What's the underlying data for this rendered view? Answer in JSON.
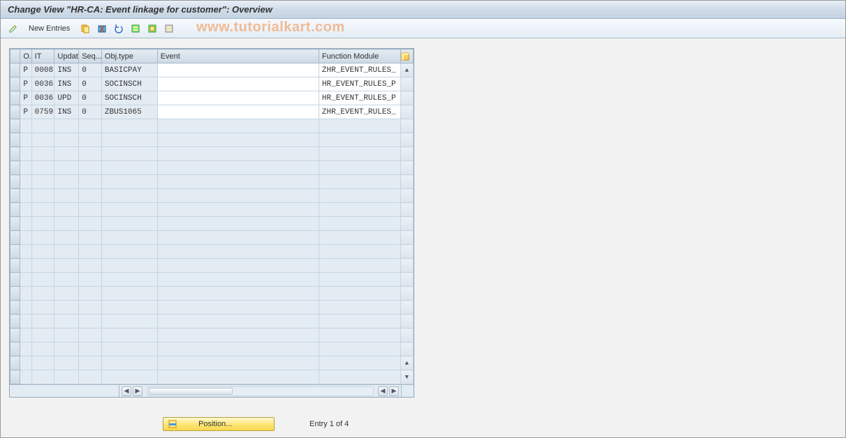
{
  "titlebar": {
    "title": "Change View \"HR-CA: Event linkage for customer\": Overview"
  },
  "toolbar": {
    "new_entries_label": "New Entries",
    "icons": {
      "pencil": "pencil-icon",
      "copy": "copy-icon",
      "delete": "delete-icon",
      "undo": "undo-icon",
      "select_all": "select-all-icon",
      "select_block": "select-block-icon",
      "deselect_all": "deselect-all-icon"
    }
  },
  "watermark": "www.tutorialkart.com",
  "grid": {
    "columns": {
      "o": "O..",
      "it": "IT",
      "updat": "Updat",
      "seq": "Seq...",
      "objtype": "Obj.type",
      "event": "Event",
      "fm": "Function Module"
    },
    "rows": [
      {
        "o": "P",
        "it": "0008",
        "updat": "INS",
        "seq": "0",
        "objtype": "BASICPAY",
        "event": "",
        "fm": "ZHR_EVENT_RULES_"
      },
      {
        "o": "P",
        "it": "0036",
        "updat": "INS",
        "seq": "0",
        "objtype": "SOCINSCH",
        "event": "",
        "fm": "HR_EVENT_RULES_P"
      },
      {
        "o": "P",
        "it": "0036",
        "updat": "UPD",
        "seq": "0",
        "objtype": "SOCINSCH",
        "event": "",
        "fm": "HR_EVENT_RULES_P"
      },
      {
        "o": "P",
        "it": "0759",
        "updat": "INS",
        "seq": "0",
        "objtype": "ZBUS1065",
        "event": "",
        "fm": "ZHR_EVENT_RULES_"
      }
    ],
    "empty_row_count": 19
  },
  "footer": {
    "position_label": "Position...",
    "entry_text": "Entry 1 of 4"
  }
}
